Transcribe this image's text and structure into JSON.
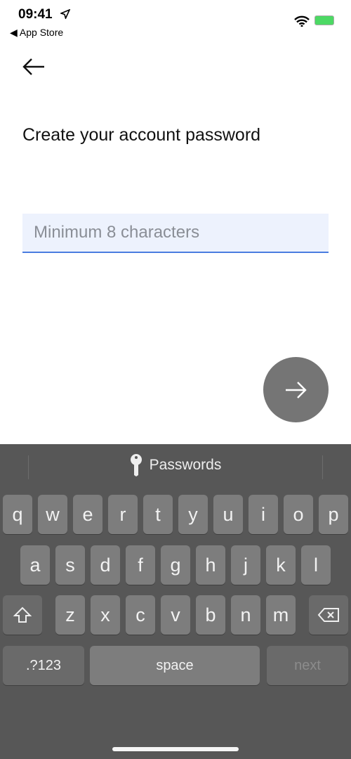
{
  "status_bar": {
    "time": "09:41",
    "back_to": "App Store",
    "icons": [
      "location-arrow-icon",
      "wifi-icon",
      "battery-charging-icon"
    ]
  },
  "page": {
    "title": "Create your account password",
    "password_placeholder": "Minimum 8 characters",
    "password_value": ""
  },
  "keyboard": {
    "suggestion": "Passwords",
    "row1": [
      "q",
      "w",
      "e",
      "r",
      "t",
      "y",
      "u",
      "i",
      "o",
      "p"
    ],
    "row2": [
      "a",
      "s",
      "d",
      "f",
      "g",
      "h",
      "j",
      "k",
      "l"
    ],
    "row3": [
      "z",
      "x",
      "c",
      "v",
      "b",
      "n",
      "m"
    ],
    "numbers_label": ".?123",
    "space_label": "space",
    "next_label": "next"
  },
  "colors": {
    "accent": "#4a7de0",
    "field_bg": "#edf2fd",
    "fab": "#757575",
    "keyboard_bg": "#575757",
    "key": "#7d7d7d"
  }
}
